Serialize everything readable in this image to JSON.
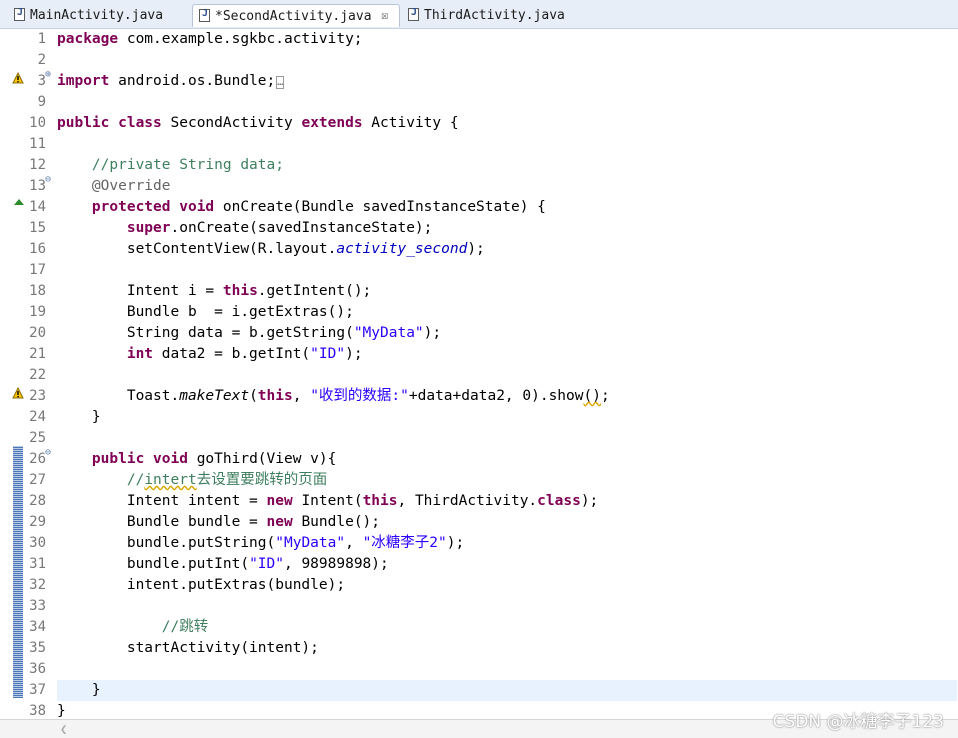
{
  "tabs": [
    {
      "label": "MainActivity.java"
    },
    {
      "label": "*SecondActivity.java"
    },
    {
      "label": "ThirdActivity.java"
    }
  ],
  "tab_close_glyph": "☒",
  "line_numbers": [
    "1",
    "2",
    "3",
    "9",
    "10",
    "11",
    "12",
    "13",
    "14",
    "15",
    "16",
    "17",
    "18",
    "19",
    "20",
    "21",
    "22",
    "23",
    "24",
    "25",
    "26",
    "27",
    "28",
    "29",
    "30",
    "31",
    "32",
    "33",
    "34",
    "35",
    "36",
    "37",
    "38"
  ],
  "code": {
    "l1_pkg": "package",
    "l1_name": " com.example.sgkbc.activity;",
    "l3_import": "import",
    "l3_name": " android.os.Bundle;",
    "l3_fold": "…",
    "l10_public": "public",
    "l10_class": " class",
    "l10_name": " SecondActivity ",
    "l10_extends": "extends",
    "l10_rest": " Activity {",
    "l12_comment": "    //private String data;",
    "l13_ann": "    @Override",
    "l14_protected": "    protected",
    "l14_void": " void",
    "l14_rest": " onCreate(Bundle savedInstanceState) {",
    "l15_super": "        super",
    "l15_rest": ".onCreate(savedInstanceState);",
    "l16_pre": "        setContentView(R.layout.",
    "l16_field": "activity_second",
    "l16_post": ");",
    "l18_pre": "        Intent i = ",
    "l18_this": "this",
    "l18_post": ".getIntent();",
    "l19": "        Bundle b  = i.getExtras();",
    "l20_pre": "        String data = b.getString(",
    "l20_str": "\"MyData\"",
    "l20_post": ");",
    "l21_int": "        int",
    "l21_pre": " data2 = b.getInt(",
    "l21_str": "\"ID\"",
    "l21_post": ");",
    "l23_pre": "        Toast.",
    "l23_method": "makeText",
    "l23_open": "(",
    "l23_this": "this",
    "l23_comma": ", ",
    "l23_str": "\"收到的数据:\"",
    "l23_post": "+data+data2, 0).show",
    "l23_paren": "()",
    "l23_semi": ";",
    "l24": "    }",
    "l26_public": "    public",
    "l26_void": " void",
    "l26_rest": " goThird(View v){",
    "l27_pre": "        //",
    "l27_word": "intert",
    "l27_post": "去设置要跳转的页面",
    "l28_pre": "        Intent intent = ",
    "l28_new": "new",
    "l28_mid": " Intent(",
    "l28_this": "this",
    "l28_mid2": ", ThirdActivity.",
    "l28_class": "class",
    "l28_post": ");",
    "l29_pre": "        Bundle bundle = ",
    "l29_new": "new",
    "l29_post": " Bundle();",
    "l30_pre": "        bundle.putString(",
    "l30_str1": "\"MyData\"",
    "l30_comma": ", ",
    "l30_str2": "\"冰糖李子2\"",
    "l30_post": ");",
    "l31_pre": "        bundle.putInt(",
    "l31_str": "\"ID\"",
    "l31_post": ", 98989898);",
    "l32": "        intent.putExtras(bundle);",
    "l34": "            //跳转",
    "l35": "        startActivity(intent);",
    "l37": "    }",
    "l38": "}"
  },
  "watermark": "CSDN @冰糖李子123",
  "colors": {
    "keyword": "#7f0055",
    "string": "#2a00ff",
    "comment": "#3f7f5f",
    "annotation": "#646464",
    "field": "#0000c0",
    "current_line": "#e8f2fe"
  }
}
